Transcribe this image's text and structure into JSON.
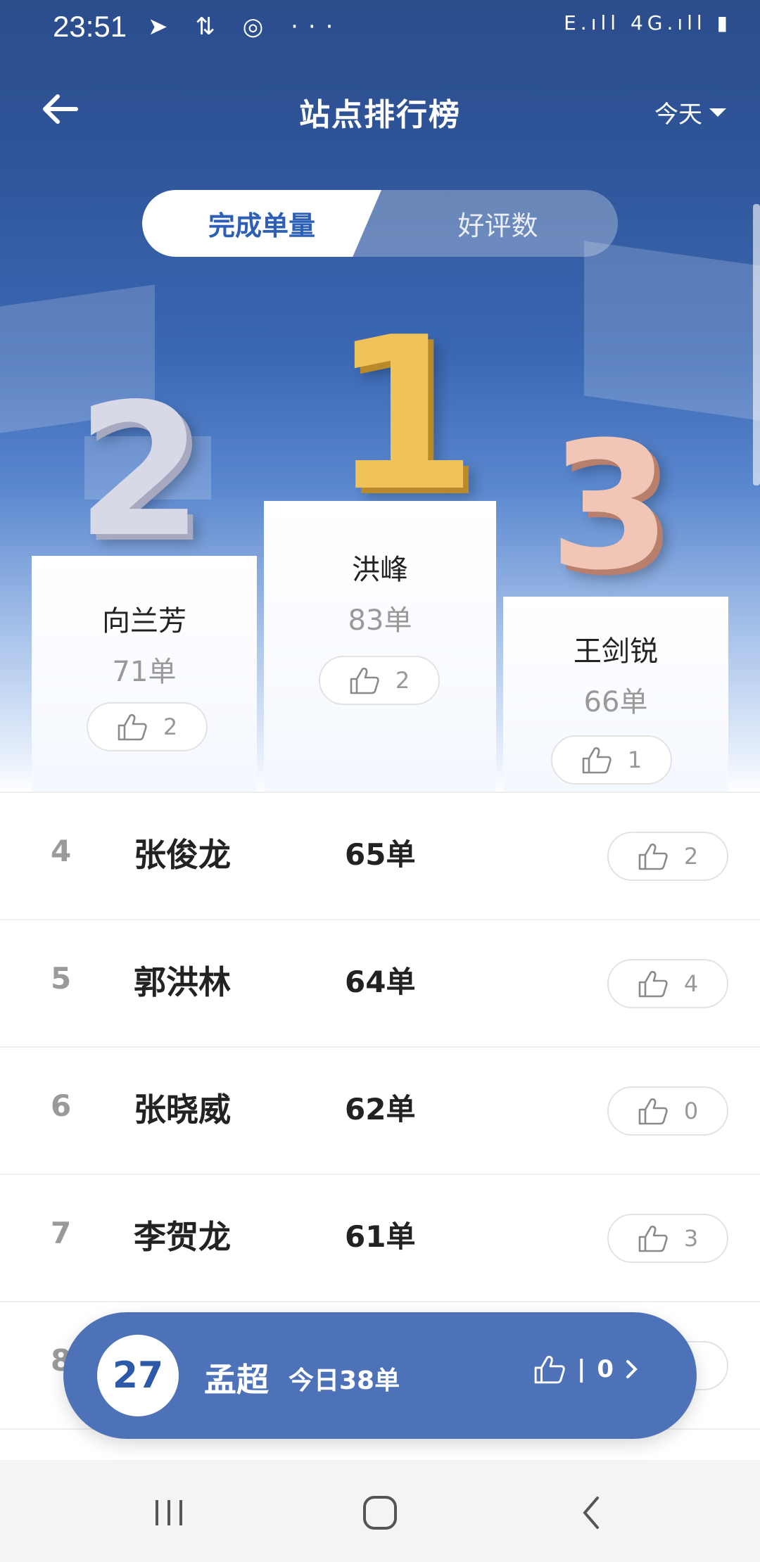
{
  "status_bar": {
    "time": "23:51",
    "icons": "➤ ⇅ ◎ ···",
    "right": "E.ıll 4G.ıll ▮"
  },
  "header": {
    "title": "站点排行榜",
    "date_filter": "今天"
  },
  "tabs": [
    {
      "label": "完成单量",
      "active": true
    },
    {
      "label": "好评数",
      "active": false
    }
  ],
  "podium": {
    "first": {
      "rank": "1",
      "name": "洪峰",
      "count": "83单",
      "likes": "2"
    },
    "second": {
      "rank": "2",
      "name": "向兰芳",
      "count": "71单",
      "likes": "2"
    },
    "third": {
      "rank": "3",
      "name": "王剑锐",
      "count": "66单",
      "likes": "1"
    }
  },
  "list": [
    {
      "rank": "4",
      "name": "张俊龙",
      "count": "65单",
      "likes": "2"
    },
    {
      "rank": "5",
      "name": "郭洪林",
      "count": "64单",
      "likes": "4"
    },
    {
      "rank": "6",
      "name": "张晓威",
      "count": "62单",
      "likes": "0"
    },
    {
      "rank": "7",
      "name": "李贺龙",
      "count": "61单",
      "likes": "3"
    },
    {
      "rank": "8",
      "name": "",
      "count": "",
      "likes": ""
    }
  ],
  "me": {
    "rank": "27",
    "name": "孟超",
    "today": "今日38单",
    "likes": "0",
    "separator": "|"
  },
  "colors": {
    "primary": "#2f5599",
    "accent": "#2c5fb5",
    "card": "#4d72b8",
    "gold": "#f0c25a",
    "silver": "#d7d9e6",
    "bronze": "#f1c6b6"
  }
}
